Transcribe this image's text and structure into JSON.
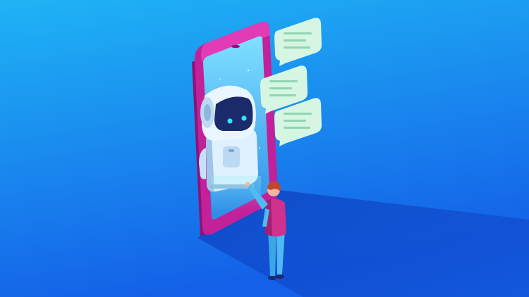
{
  "illustration": {
    "subject": "isometric-chatbot-smartphone",
    "icons": [
      "smartphone",
      "robot",
      "chat-bubble",
      "person"
    ],
    "colors": {
      "background_top": "#1fb4f5",
      "background_bottom": "#1460e8",
      "phone_frame": "#c2219a",
      "phone_frame_light": "#e23bb6",
      "phone_screen": "#5fd0ff",
      "robot_body": "#dff1ff",
      "robot_visor": "#1b2a6b",
      "robot_eyes": "#38e2ff",
      "chat_bubble": "#d6f6e3",
      "chat_text_lines": "#8fd6b0",
      "person_shirt": "#d0318f",
      "person_pants": "#4fb9f2",
      "person_hair": "#c2452e"
    },
    "chat_bubble_count": 3
  }
}
